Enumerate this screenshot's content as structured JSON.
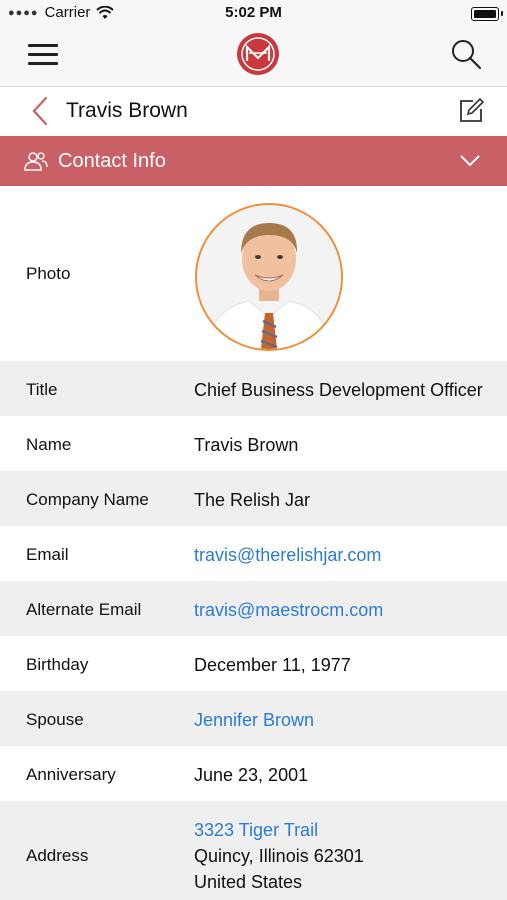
{
  "status_bar": {
    "carrier": "Carrier",
    "time": "5:02 PM"
  },
  "header": {
    "title": "Travis Brown"
  },
  "section": {
    "label": "Contact Info"
  },
  "fields": {
    "photo_label": "Photo",
    "title_label": "Title",
    "title_value": "Chief Business Development Officer",
    "name_label": "Name",
    "name_value": "Travis Brown",
    "company_label": "Company Name",
    "company_value": "The Relish Jar",
    "email_label": "Email",
    "email_value": "travis@therelishjar.com",
    "alt_email_label": "Alternate Email",
    "alt_email_value": "travis@maestrocm.com",
    "birthday_label": "Birthday",
    "birthday_value": "December 11, 1977",
    "spouse_label": "Spouse",
    "spouse_value": "Jennifer Brown",
    "anniversary_label": "Anniversary",
    "anniversary_value": "June 23, 2001",
    "address_label": "Address",
    "address_line1": "3323 Tiger Trail",
    "address_line2": "Quincy, Illinois 62301",
    "address_line3": "United States"
  },
  "colors": {
    "accent": "#c96066",
    "link": "#2b7bd6",
    "photo_ring": "#ef8e36"
  },
  "icons": [
    "wifi-icon",
    "battery-icon",
    "menu-icon",
    "app-logo-icon",
    "search-icon",
    "back-chevron-icon",
    "edit-icon",
    "contacts-icon",
    "chevron-down-icon"
  ]
}
